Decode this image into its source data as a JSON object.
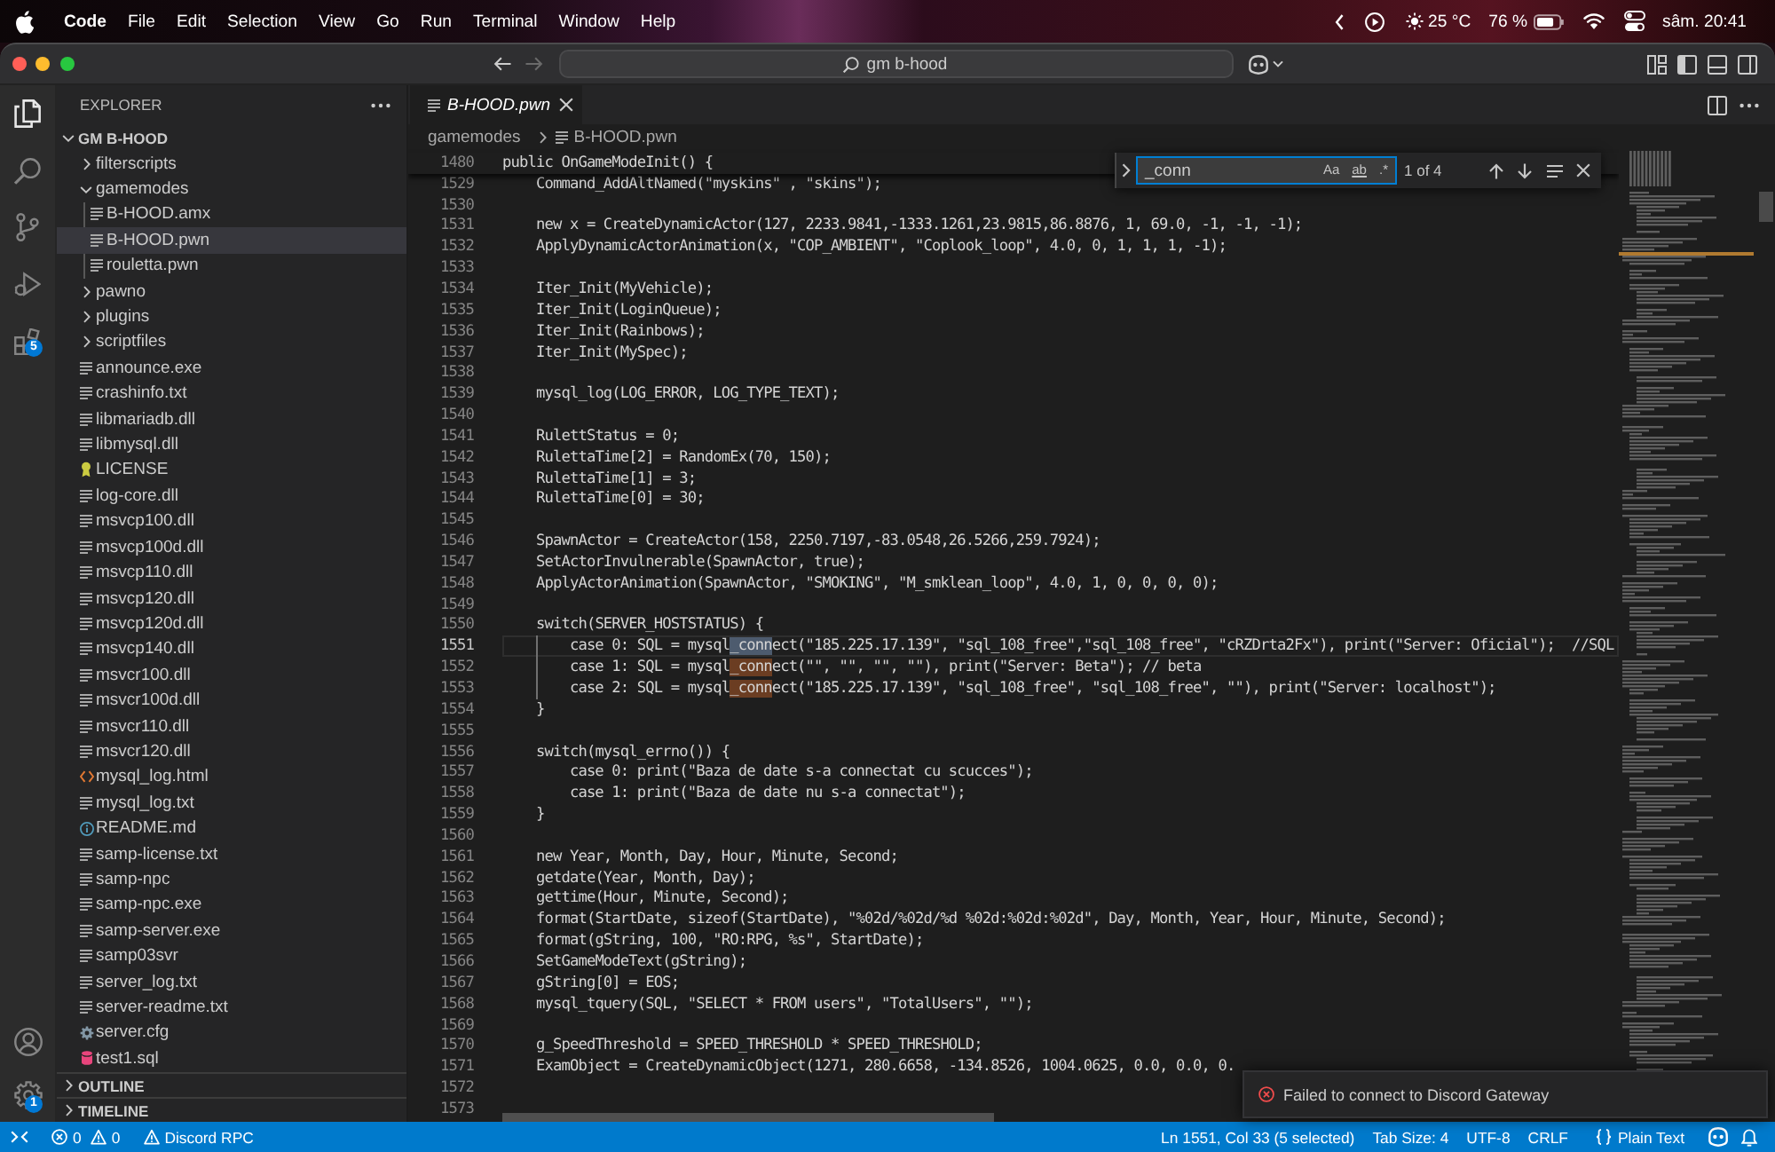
{
  "menu_bar": {
    "app_name": "Code",
    "menus": [
      "File",
      "Edit",
      "Selection",
      "View",
      "Go",
      "Run",
      "Terminal",
      "Window",
      "Help"
    ],
    "weather": "25 °C",
    "battery": "76 %",
    "clock": "sâm. 20:41"
  },
  "title_bar": {
    "navigation": [
      {
        "kind": "back",
        "disabled": false
      },
      {
        "kind": "forward",
        "disabled": true
      }
    ],
    "search": "gm b-hood"
  },
  "activity_bar": {
    "items": [
      {
        "kind": "explorer",
        "selected": true
      },
      {
        "kind": "search",
        "selected": false
      },
      {
        "kind": "source-control",
        "selected": false
      },
      {
        "kind": "run-debug",
        "selected": false
      },
      {
        "kind": "extensions",
        "selected": false,
        "badge": "5"
      }
    ],
    "bottom_items": [
      {
        "kind": "accounts"
      },
      {
        "kind": "manage",
        "badge": "1"
      }
    ]
  },
  "sidebar": {
    "title": "EXPLORER",
    "tree": {
      "label": "GM B-HOOD",
      "expanded": true,
      "children": [
        {
          "label": "filterscripts",
          "kind": "folder",
          "expanded": false,
          "selected": false
        },
        {
          "label": "gamemodes",
          "kind": "folder",
          "expanded": true,
          "selected": false,
          "children": [
            {
              "label": "B-HOOD.amx",
              "kind": "file",
              "selected": false
            },
            {
              "label": "B-HOOD.pwn",
              "kind": "file",
              "selected": true
            },
            {
              "label": "rouletta.pwn",
              "kind": "file",
              "selected": false
            }
          ]
        },
        {
          "label": "pawno",
          "kind": "folder",
          "expanded": false,
          "selected": false
        },
        {
          "label": "plugins",
          "kind": "folder",
          "expanded": false,
          "selected": false
        },
        {
          "label": "scriptfiles",
          "kind": "folder",
          "expanded": false,
          "selected": false
        },
        {
          "label": "announce.exe",
          "kind": "file",
          "selected": false
        },
        {
          "label": "crashinfo.txt",
          "kind": "file",
          "selected": false
        },
        {
          "label": "libmariadb.dll",
          "kind": "file",
          "selected": false
        },
        {
          "label": "libmysql.dll",
          "kind": "file",
          "selected": false
        },
        {
          "label": "LICENSE",
          "kind": "license-file",
          "selected": false
        },
        {
          "label": "log-core.dll",
          "kind": "file",
          "selected": false
        },
        {
          "label": "msvcp100.dll",
          "kind": "file",
          "selected": false
        },
        {
          "label": "msvcp100d.dll",
          "kind": "file",
          "selected": false
        },
        {
          "label": "msvcp110.dll",
          "kind": "file",
          "selected": false
        },
        {
          "label": "msvcp120.dll",
          "kind": "file",
          "selected": false
        },
        {
          "label": "msvcp120d.dll",
          "kind": "file",
          "selected": false
        },
        {
          "label": "msvcp140.dll",
          "kind": "file",
          "selected": false
        },
        {
          "label": "msvcr100.dll",
          "kind": "file",
          "selected": false
        },
        {
          "label": "msvcr100d.dll",
          "kind": "file",
          "selected": false
        },
        {
          "label": "msvcr110.dll",
          "kind": "file",
          "selected": false
        },
        {
          "label": "msvcr120.dll",
          "kind": "file",
          "selected": false
        },
        {
          "label": "mysql_log.html",
          "kind": "html-file",
          "selected": false
        },
        {
          "label": "mysql_log.txt",
          "kind": "file",
          "selected": false
        },
        {
          "label": "README.md",
          "kind": "markdown-file",
          "selected": false
        },
        {
          "label": "samp-license.txt",
          "kind": "file",
          "selected": false
        },
        {
          "label": "samp-npc",
          "kind": "file",
          "selected": false
        },
        {
          "label": "samp-npc.exe",
          "kind": "file",
          "selected": false
        },
        {
          "label": "samp-server.exe",
          "kind": "file",
          "selected": false
        },
        {
          "label": "samp03svr",
          "kind": "file",
          "selected": false
        },
        {
          "label": "server_log.txt",
          "kind": "file",
          "selected": false
        },
        {
          "label": "server-readme.txt",
          "kind": "file",
          "selected": false
        },
        {
          "label": "server.cfg",
          "kind": "config-file",
          "selected": false
        },
        {
          "label": "test1.sql",
          "kind": "sql-file",
          "selected": false
        }
      ]
    },
    "sections": [
      {
        "label": "OUTLINE",
        "expanded": false
      },
      {
        "label": "TIMELINE",
        "expanded": false
      }
    ]
  },
  "editor": {
    "tabs": [
      {
        "label": "B-HOOD.pwn",
        "selected": true,
        "preview": true
      }
    ],
    "breadcrumb": [
      {
        "label": "gamemodes",
        "kind": "folder"
      },
      {
        "label": "B-HOOD.pwn",
        "kind": "file"
      }
    ],
    "find": {
      "query": "_conn",
      "options": [
        {
          "kind": "match-case",
          "label": "Aa",
          "on": false
        },
        {
          "kind": "whole-word",
          "label": "ab",
          "on": false
        },
        {
          "kind": "regex",
          "label": ".*",
          "on": false
        }
      ],
      "result": "1 of 4"
    },
    "sticky_line": {
      "number": "1480",
      "text": "public OnGameModeInit() {"
    },
    "lines": [
      {
        "number": "1529",
        "text": "    Command_AddAltNamed(\"myskins\" , \"skins\");",
        "current": false
      },
      {
        "number": "1530",
        "current": false
      },
      {
        "number": "1531",
        "text": "    new x = CreateDynamicActor(127, 2233.9841,-1333.1261,23.9815,86.8876, 1, 69.0, -1, -1, -1);",
        "current": false
      },
      {
        "number": "1532",
        "text": "    ApplyDynamicActorAnimation(x, \"COP_AMBIENT\", \"Coplook_loop\", 4.0, 0, 1, 1, 1, -1);",
        "current": false
      },
      {
        "number": "1533",
        "current": false
      },
      {
        "number": "1534",
        "text": "    Iter_Init(MyVehicle);",
        "current": false
      },
      {
        "number": "1535",
        "text": "    Iter_Init(LoginQueue);",
        "current": false
      },
      {
        "number": "1536",
        "text": "    Iter_Init(Rainbows);",
        "current": false
      },
      {
        "number": "1537",
        "text": "    Iter_Init(MySpec);",
        "current": false
      },
      {
        "number": "1538",
        "current": false
      },
      {
        "number": "1539",
        "text": "    mysql_log(LOG_ERROR, LOG_TYPE_TEXT);",
        "current": false
      },
      {
        "number": "1540",
        "current": false
      },
      {
        "number": "1541",
        "text": "    RulettStatus = 0;",
        "current": false
      },
      {
        "number": "1542",
        "text": "    RulettaTime[2] = RandomEx(70, 150);",
        "current": false
      },
      {
        "number": "1543",
        "text": "    RulettaTime[1] = 3;",
        "current": false
      },
      {
        "number": "1544",
        "text": "    RulettaTime[0] = 30;",
        "current": false
      },
      {
        "number": "1545",
        "current": false
      },
      {
        "number": "1546",
        "text": "    SpawnActor = CreateActor(158, 2250.7197,-83.0548,26.5266,259.7924);",
        "current": false
      },
      {
        "number": "1547",
        "text": "    SetActorInvulnerable(SpawnActor, true);",
        "current": false
      },
      {
        "number": "1548",
        "text": "    ApplyActorAnimation(SpawnActor, \"SMOKING\", \"M_smklean_loop\", 4.0, 1, 0, 0, 0, 0);",
        "current": false
      },
      {
        "number": "1549",
        "current": false
      },
      {
        "number": "1550",
        "text": "    switch(SERVER_HOSTSTATUS) {",
        "current": false
      },
      {
        "number": "1551",
        "segments": [
          {
            "text": "        case 0: SQL = mysql",
            "kind": "plain"
          },
          {
            "text": "_conn",
            "kind": "current-match"
          },
          {
            "text": "ect(\"185.225.17.139\", \"sql_108_free\",\"sql_108_free\", \"cRZDrta2Fx\"), print(\"Server: Oficial\");  //SQL",
            "kind": "plain"
          }
        ],
        "current": true
      },
      {
        "number": "1552",
        "segments": [
          {
            "text": "        case 1: SQL = mysql",
            "kind": "plain"
          },
          {
            "text": "_conn",
            "kind": "match"
          },
          {
            "text": "ect(\"\", \"\", \"\", \"\"), print(\"Server: Beta\"); // beta",
            "kind": "plain"
          }
        ],
        "current": false
      },
      {
        "number": "1553",
        "segments": [
          {
            "text": "        case 2: SQL = mysql",
            "kind": "plain"
          },
          {
            "text": "_conn",
            "kind": "match"
          },
          {
            "text": "ect(\"185.225.17.139\", \"sql_108_free\", \"sql_108_free\", \"\"), print(\"Server: localhost\");",
            "kind": "plain"
          }
        ],
        "current": false
      },
      {
        "number": "1554",
        "text": "    }",
        "current": false
      },
      {
        "number": "1555",
        "current": false
      },
      {
        "number": "1556",
        "text": "    switch(mysql_errno()) {",
        "current": false
      },
      {
        "number": "1557",
        "text": "        case 0: print(\"Baza de date s-a connectat cu scucces\");",
        "current": false
      },
      {
        "number": "1558",
        "text": "        case 1: print(\"Baza de date nu s-a connectat\");",
        "current": false
      },
      {
        "number": "1559",
        "text": "    }",
        "current": false
      },
      {
        "number": "1560",
        "current": false
      },
      {
        "number": "1561",
        "text": "    new Year, Month, Day, Hour, Minute, Second;",
        "current": false
      },
      {
        "number": "1562",
        "text": "    getdate(Year, Month, Day);",
        "current": false
      },
      {
        "number": "1563",
        "text": "    gettime(Hour, Minute, Second);",
        "current": false
      },
      {
        "number": "1564",
        "text": "    format(StartDate, sizeof(StartDate), \"%02d/%02d/%d %02d:%02d:%02d\", Day, Month, Year, Hour, Minute, Second);",
        "current": false
      },
      {
        "number": "1565",
        "text": "    format(gString, 100, \"RO:RPG, %s\", StartDate);",
        "current": false
      },
      {
        "number": "1566",
        "text": "    SetGameModeText(gString);",
        "current": false
      },
      {
        "number": "1567",
        "text": "    gString[0] = EOS;",
        "current": false
      },
      {
        "number": "1568",
        "text": "    mysql_tquery(SQL, \"SELECT * FROM users\", \"TotalUsers\", \"\");",
        "current": false
      },
      {
        "number": "1569",
        "current": false
      },
      {
        "number": "1570",
        "text": "    g_SpeedThreshold = SPEED_THRESHOLD * SPEED_THRESHOLD;",
        "current": false
      },
      {
        "number": "1571",
        "text": "    ExamObject = CreateDynamicObject(1271, 280.6658, -134.8526, 1004.0625, 0.0, 0.0, 0.",
        "current": false
      },
      {
        "number": "1572",
        "current": false
      },
      {
        "number": "1573",
        "current": false
      }
    ]
  },
  "notification": {
    "kind": "error",
    "message": "Failed to connect to Discord Gateway"
  },
  "status_bar": {
    "errors": "0",
    "warnings": "0",
    "extension_status": "Discord RPC",
    "cursor": "Ln 1551, Col 33 (5 selected)",
    "indentation": "Tab Size: 4",
    "encoding": "UTF-8",
    "line_ending": "CRLF",
    "language": "Plain Text"
  }
}
